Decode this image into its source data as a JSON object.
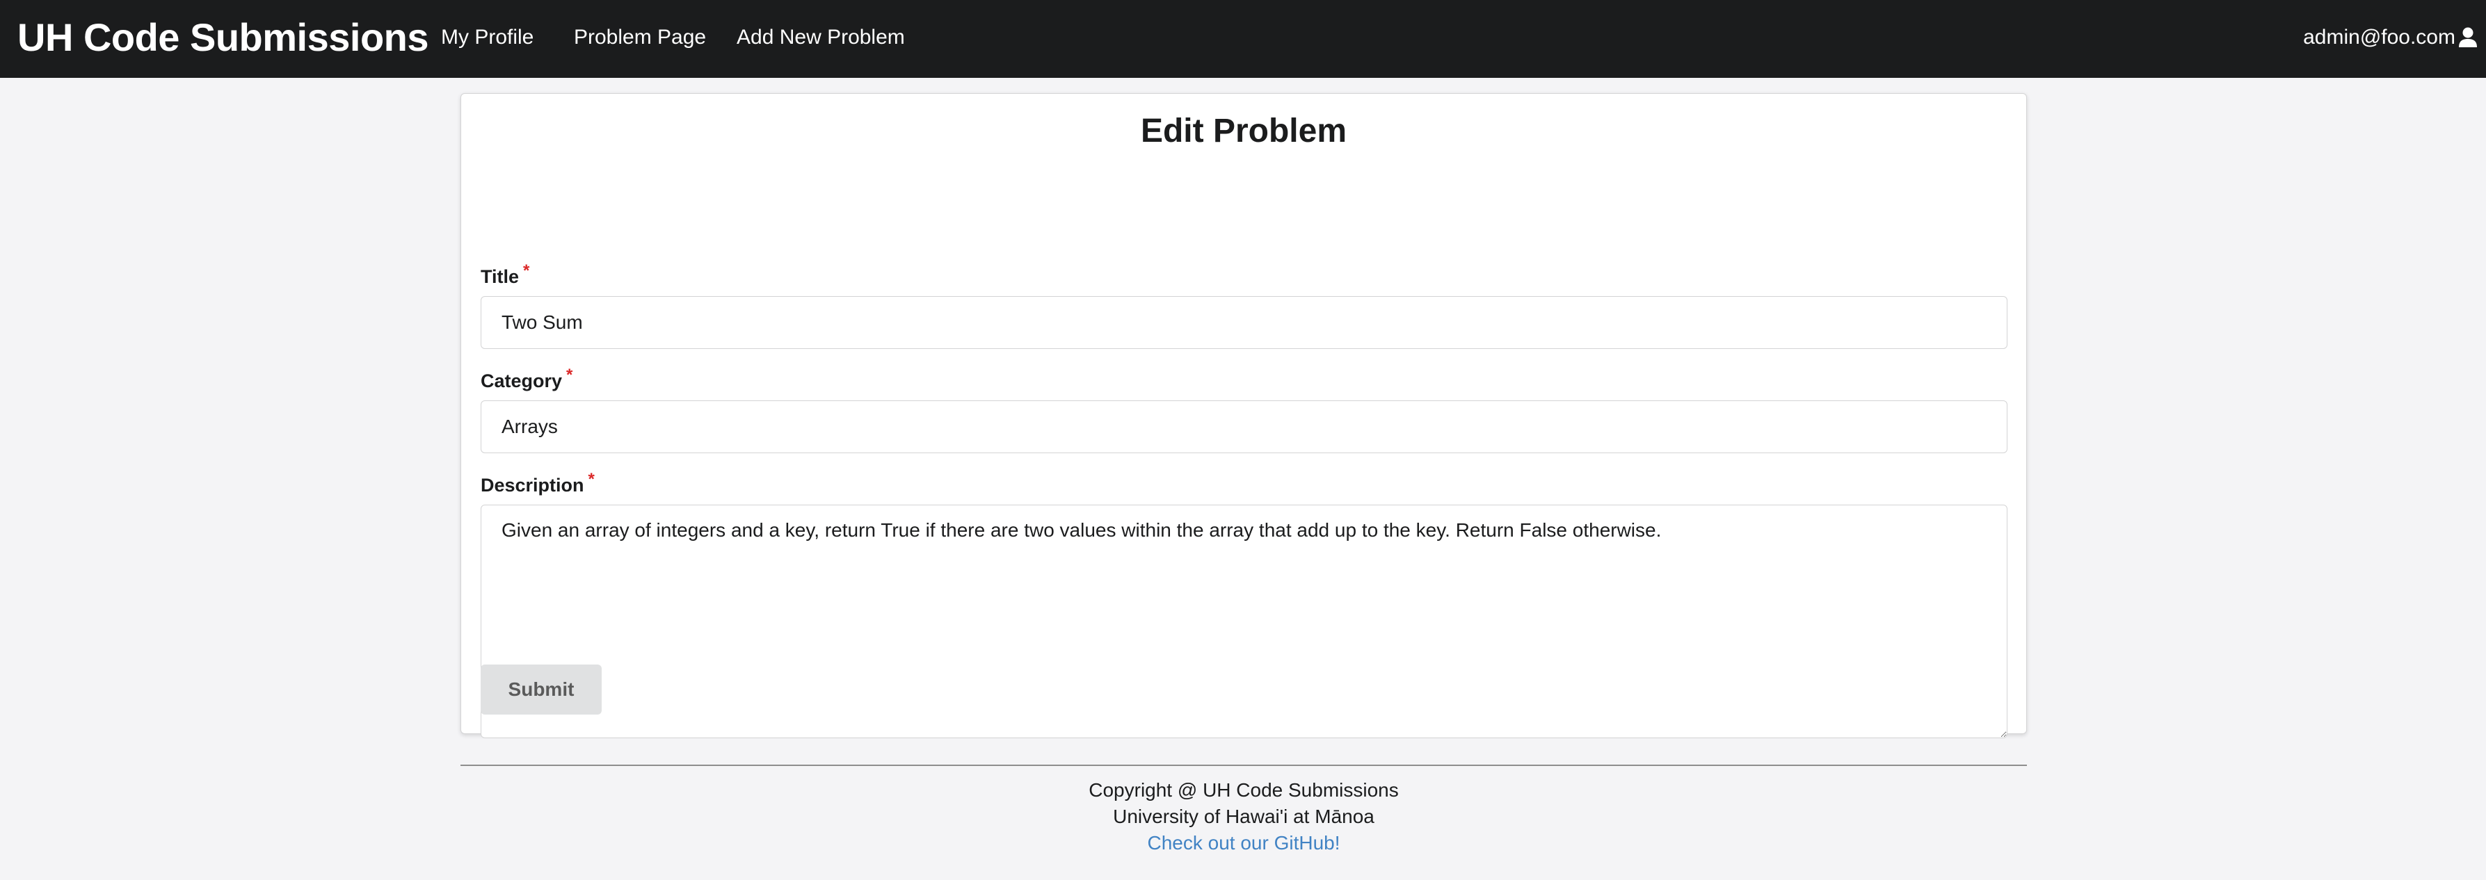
{
  "navbar": {
    "brand": "UH Code Submissions",
    "links": [
      "My Profile",
      "Problem Page",
      "Add New Problem"
    ],
    "user_email": "admin@foo.com",
    "user_icon": "user-icon"
  },
  "form": {
    "heading": "Edit Problem",
    "required_marker": "*",
    "title_label": "Title",
    "title_value": "Two Sum",
    "category_label": "Category",
    "category_value": "Arrays",
    "description_label": "Description",
    "description_value": "Given an array of integers and a key, return True if there are two values within the array that add up to the key. Return False otherwise.",
    "submit_label": "Submit"
  },
  "footer": {
    "copyright": "Copyright @ UH Code Submissions",
    "university": "University of Hawai'i at Mānoa",
    "github_link": "Check out our GitHub!"
  },
  "colors": {
    "navbar_bg": "#1b1c1d",
    "page_bg": "#f4f4f6",
    "required": "#db2828",
    "link": "#4183c4",
    "button_bg": "#e0e1e2"
  }
}
